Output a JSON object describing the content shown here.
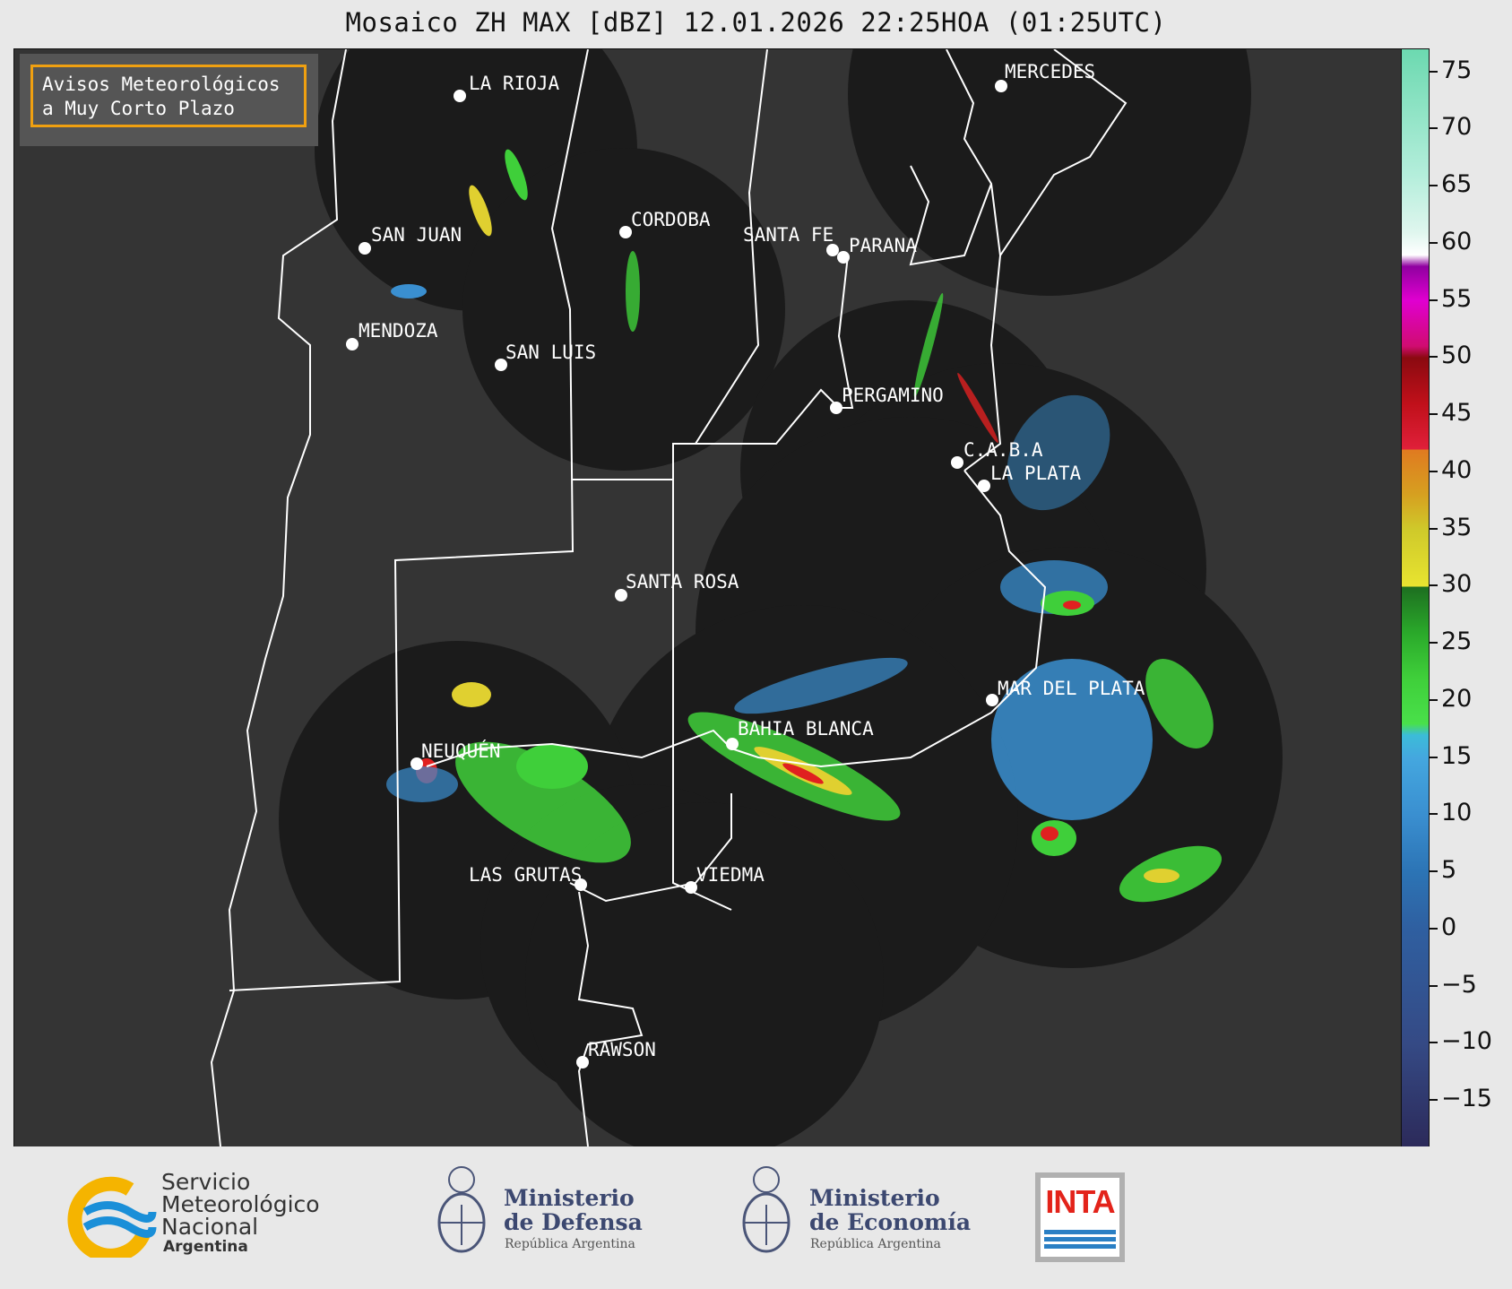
{
  "title": "Mosaico ZH MAX [dBZ] 12.01.2026 22:25HOA (01:25UTC)",
  "avisos": {
    "line1": "Avisos Meteorológicos",
    "line2": "a Muy Corto Plazo",
    "border_color": "#f0a010"
  },
  "cities": [
    {
      "name": "LA RIOJA"
    },
    {
      "name": "MERCEDES"
    },
    {
      "name": "SAN JUAN"
    },
    {
      "name": "CORDOBA"
    },
    {
      "name": "SANTA FE"
    },
    {
      "name": "PARANA"
    },
    {
      "name": "MENDOZA"
    },
    {
      "name": "SAN LUIS"
    },
    {
      "name": "PERGAMINO"
    },
    {
      "name": "C.A.B.A"
    },
    {
      "name": "LA PLATA"
    },
    {
      "name": "SANTA ROSA"
    },
    {
      "name": "MAR DEL PLATA"
    },
    {
      "name": "BAHIA BLANCA"
    },
    {
      "name": "NEUQUÉN"
    },
    {
      "name": "LAS GRUTAS"
    },
    {
      "name": "VIEDMA"
    },
    {
      "name": "RAWSON"
    }
  ],
  "colorbar": {
    "ticks": [
      "75",
      "70",
      "65",
      "60",
      "55",
      "50",
      "45",
      "40",
      "35",
      "30",
      "25",
      "20",
      "15",
      "10",
      "5",
      "0",
      "−5",
      "−10",
      "−15"
    ],
    "colors": {
      "light_rain": "#3a8fd0",
      "moderate": "#3fcf3a",
      "heavy": "#e0d030",
      "intense": "#e02020",
      "extreme": "#d000c0"
    }
  },
  "footer": {
    "smn_line1": "Servicio",
    "smn_line2": "Meteorológico",
    "smn_line3": "Nacional",
    "smn_line4": "Argentina",
    "defensa_line1": "Ministerio",
    "defensa_line2": "de Defensa",
    "defensa_sub": "República Argentina",
    "economia_line1": "Ministerio",
    "economia_line2": "de Economía",
    "economia_sub": "República Argentina",
    "inta": "INTA"
  }
}
